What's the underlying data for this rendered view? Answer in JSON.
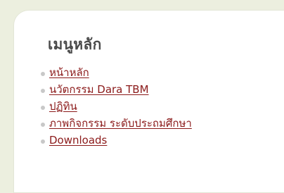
{
  "menu": {
    "heading": "เมนูหลัก",
    "items": [
      {
        "label": "หน้าหลัก"
      },
      {
        "label": "นวัตกรรม Dara TBM"
      },
      {
        "label": "ปฏิทิน"
      },
      {
        "label": "ภาพกิจกรรม ระดับประถมศึกษา"
      },
      {
        "label": "Downloads"
      }
    ]
  },
  "colors": {
    "page_background": "#ecefdf",
    "panel_background": "#ffffff",
    "link": "#8b1a1a",
    "heading": "#4a4a4a",
    "bullet": "#c8c8c8"
  }
}
